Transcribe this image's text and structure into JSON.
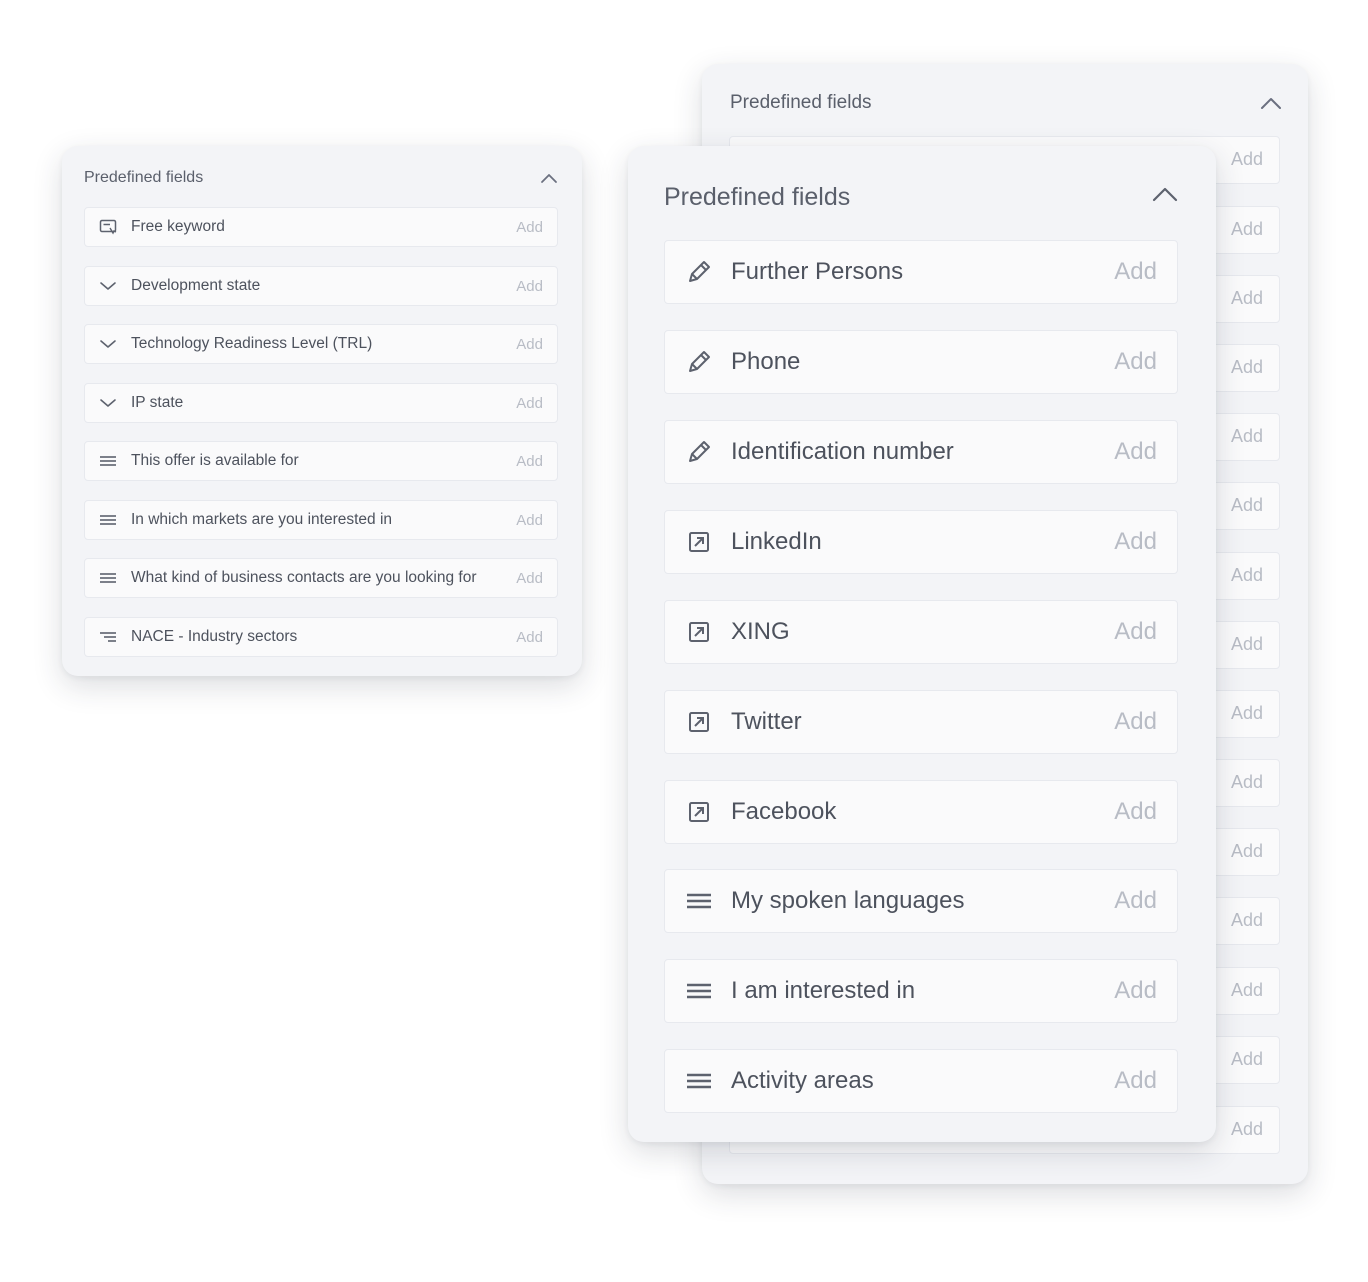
{
  "back_panel": {
    "title": "Predefined fields",
    "rows": [
      {
        "add": "Add"
      },
      {
        "add": "Add"
      },
      {
        "add": "Add"
      },
      {
        "add": "Add"
      },
      {
        "add": "Add"
      },
      {
        "add": "Add"
      },
      {
        "add": "Add"
      },
      {
        "add": "Add"
      },
      {
        "add": "Add"
      },
      {
        "add": "Add"
      },
      {
        "add": "Add"
      },
      {
        "add": "Add"
      },
      {
        "add": "Add"
      },
      {
        "add": "Add"
      },
      {
        "add": "Add"
      }
    ]
  },
  "left_panel": {
    "title": "Predefined fields",
    "items": [
      {
        "icon": "text-field-icon",
        "label": "Free keyword",
        "add": "Add"
      },
      {
        "icon": "chevron-down-icon",
        "label": "Development state",
        "add": "Add"
      },
      {
        "icon": "chevron-down-icon",
        "label": "Technology Readiness Level (TRL)",
        "add": "Add"
      },
      {
        "icon": "chevron-down-icon",
        "label": "IP state",
        "add": "Add"
      },
      {
        "icon": "list-icon",
        "label": "This offer is available for",
        "add": "Add"
      },
      {
        "icon": "list-icon",
        "label": "In which markets are you interested in",
        "add": "Add"
      },
      {
        "icon": "list-icon",
        "label": "What kind of business contacts are you looking for",
        "add": "Add"
      },
      {
        "icon": "tree-list-icon",
        "label": "NACE - Industry sectors",
        "add": "Add"
      }
    ]
  },
  "front_panel": {
    "title": "Predefined fields",
    "items": [
      {
        "icon": "pencil-icon",
        "label": "Further Persons",
        "add": "Add"
      },
      {
        "icon": "pencil-icon",
        "label": "Phone",
        "add": "Add"
      },
      {
        "icon": "pencil-icon",
        "label": "Identification number",
        "add": "Add"
      },
      {
        "icon": "external-link-icon",
        "label": "LinkedIn",
        "add": "Add"
      },
      {
        "icon": "external-link-icon",
        "label": "XING",
        "add": "Add"
      },
      {
        "icon": "external-link-icon",
        "label": "Twitter",
        "add": "Add"
      },
      {
        "icon": "external-link-icon",
        "label": "Facebook",
        "add": "Add"
      },
      {
        "icon": "list-icon",
        "label": "My spoken languages",
        "add": "Add"
      },
      {
        "icon": "list-icon",
        "label": "I am interested in",
        "add": "Add"
      },
      {
        "icon": "list-icon",
        "label": "Activity areas",
        "add": "Add"
      }
    ]
  }
}
